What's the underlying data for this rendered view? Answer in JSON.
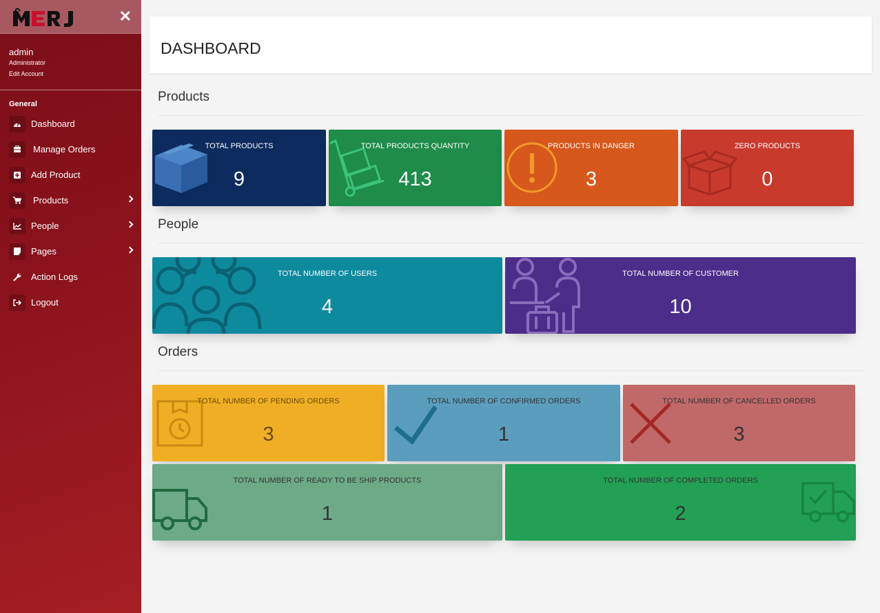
{
  "brand": {
    "logo_text": "MERJ"
  },
  "user": {
    "name": "admin",
    "role": "Administrator",
    "edit": "Edit Account"
  },
  "sidebar": {
    "section": "General",
    "items": [
      {
        "label": "Dashboard",
        "icon": "dashboard-icon"
      },
      {
        "label": "Manage Orders",
        "icon": "orders-icon"
      },
      {
        "label": "Add Product",
        "icon": "plus-square-icon"
      },
      {
        "label": "Products",
        "icon": "cart-icon"
      },
      {
        "label": "People",
        "icon": "chart-icon"
      },
      {
        "label": "Pages",
        "icon": "page-icon"
      },
      {
        "label": "Action Logs",
        "icon": "wrench-icon"
      },
      {
        "label": "Logout",
        "icon": "logout-icon"
      }
    ]
  },
  "header": {
    "title": "DASHBOARD"
  },
  "sections": {
    "products": "Products",
    "people": "People",
    "orders": "Orders"
  },
  "cards": {
    "total_products": {
      "title": "TOTAL PRODUCTS",
      "value": "9",
      "color": "#0d2b5e"
    },
    "total_quantity": {
      "title": "TOTAL PRODUCTS QUANTITY",
      "value": "413",
      "color": "#1f8c4a"
    },
    "in_danger": {
      "title": "PRODUCTS IN DANGER",
      "value": "3",
      "color": "#d6581c"
    },
    "zero_products": {
      "title": "ZERO PRODUCTS",
      "value": "0",
      "color": "#c83a2c"
    },
    "users": {
      "title": "TOTAL NUMBER OF USERS",
      "value": "4",
      "color": "#0e8a9e"
    },
    "customers": {
      "title": "TOTAL NUMBER OF CUSTOMER",
      "value": "10",
      "color": "#4b2e8a"
    },
    "pending": {
      "title": "TOTAL NUMBER OF PENDING ORDERS",
      "value": "3",
      "color": "#f0ae24"
    },
    "confirmed": {
      "title": "TOTAL NUMBER OF CONFIRMED ORDERS",
      "value": "1",
      "color": "#5b9dbd"
    },
    "cancelled": {
      "title": "TOTAL NUMBER OF CANCELLED ORDERS",
      "value": "3",
      "color": "#c16868"
    },
    "ready_ship": {
      "title": "TOTAL NUMBER OF READY TO BE SHIP PRODUCTS",
      "value": "1",
      "color": "#6caa88"
    },
    "completed": {
      "title": "TOTAL NUMBER OF COMPLETED ORDERS",
      "value": "2",
      "color": "#22a054"
    }
  }
}
